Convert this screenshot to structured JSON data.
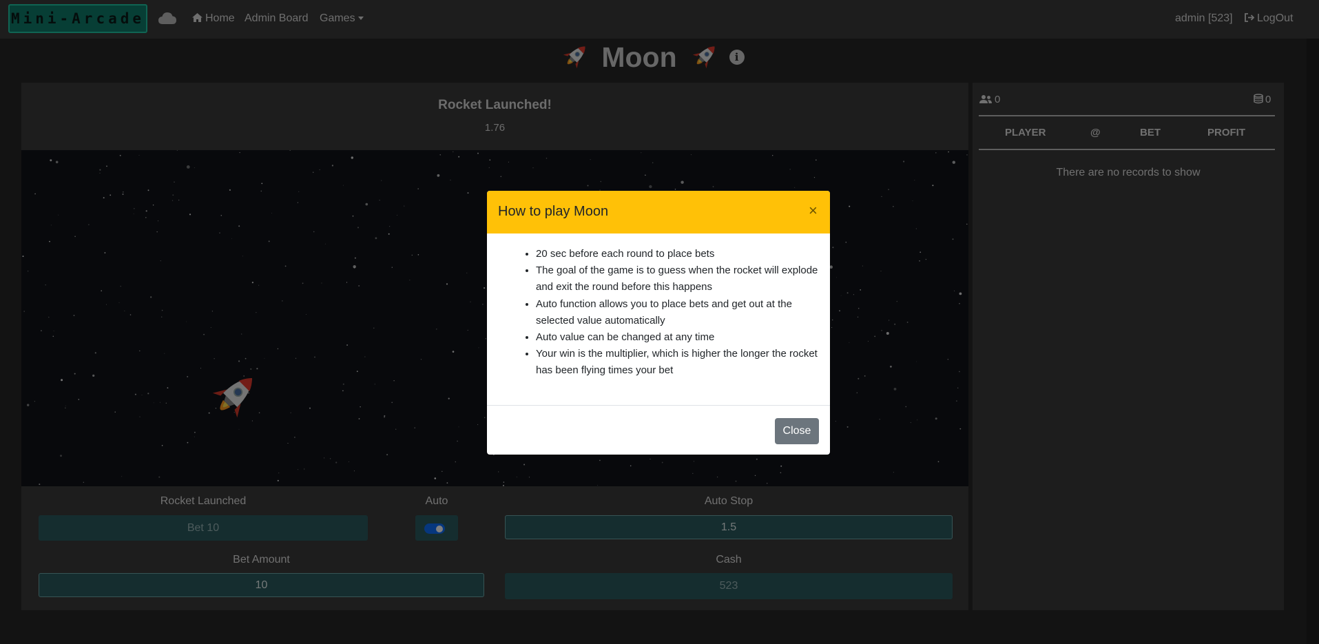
{
  "navbar": {
    "brand": "Mini-Arcade",
    "cloud_icon": "cloud-icon",
    "home": "Home",
    "admin_board": "Admin Board",
    "games": "Games",
    "user": "admin [523]",
    "logout": "LogOut"
  },
  "page": {
    "title": "Moon",
    "rocket_icon": "rocket-icon",
    "info_icon": "info-icon"
  },
  "game": {
    "status_title": "Rocket Launched!",
    "multiplier": "1.76",
    "controls": {
      "bet_button_label": "Rocket Launched",
      "bet_button_value": "Bet 10",
      "auto_label": "Auto",
      "auto_enabled": true,
      "auto_stop_label": "Auto Stop",
      "auto_stop_value": "1.5",
      "bet_amount_label": "Bet Amount",
      "bet_amount_value": "10",
      "cash_label": "Cash",
      "cash_value": "523"
    }
  },
  "sidebar": {
    "players_count": "0",
    "coins_count": "0",
    "table_headers": [
      "PLAYER",
      "@",
      "BET",
      "PROFIT"
    ],
    "empty_text": "There are no records to show"
  },
  "modal": {
    "title": "How to play Moon",
    "close_symbol": "×",
    "rules": [
      "20 sec before each round to place bets",
      "The goal of the game is to guess when the rocket will explode and exit the round before this happens",
      "Auto function allows you to place bets and get out at the selected value automatically",
      "Auto value can be changed at any time",
      "Your win is the multiplier, which is higher the longer the rocket has been flying times your bet"
    ],
    "close_button": "Close"
  },
  "colors": {
    "modal_header": "#ffc107",
    "brand_border": "#20c9a6",
    "control_bg": "#2b5a5f",
    "close_button": "#6c757d"
  }
}
